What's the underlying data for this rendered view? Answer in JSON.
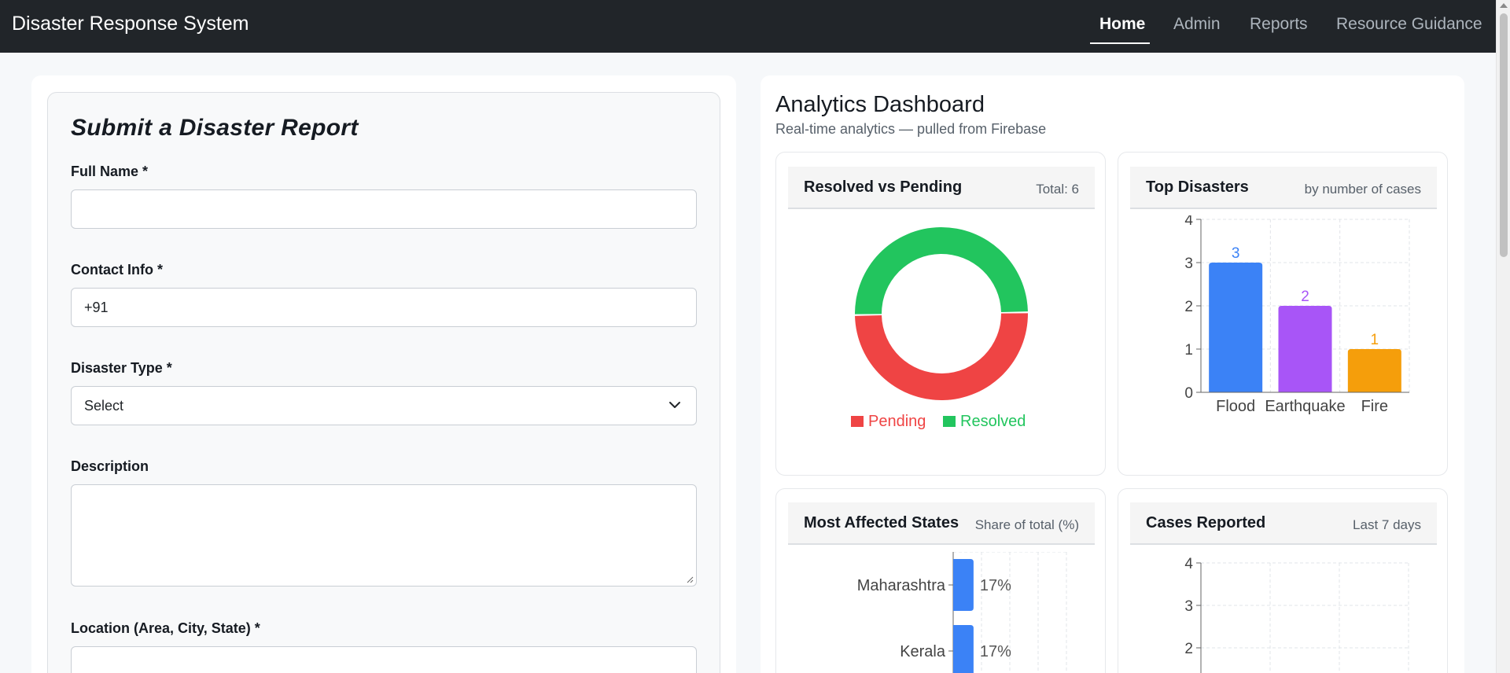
{
  "nav": {
    "brand": "Disaster Response System",
    "links": [
      {
        "label": "Home",
        "active": true
      },
      {
        "label": "Admin",
        "active": false
      },
      {
        "label": "Reports",
        "active": false
      },
      {
        "label": "Resource Guidance",
        "active": false
      }
    ]
  },
  "form": {
    "title": "Submit a Disaster Report",
    "full_name_label": "Full Name *",
    "full_name_value": "",
    "contact_label": "Contact Info *",
    "contact_value": "+91",
    "disaster_type_label": "Disaster Type *",
    "disaster_type_value": "Select",
    "description_label": "Description",
    "description_value": "",
    "location_label": "Location (Area, City, State) *",
    "location_value": ""
  },
  "dashboard": {
    "title": "Analytics Dashboard",
    "subtitle": "Real-time analytics — pulled from Firebase",
    "cards": {
      "resolved_pending": {
        "title": "Resolved vs Pending",
        "meta": "Total: 6"
      },
      "top_disasters": {
        "title": "Top Disasters",
        "meta": "by number of cases"
      },
      "affected_states": {
        "title": "Most Affected States",
        "meta": "Share of total (%)"
      },
      "cases_reported": {
        "title": "Cases Reported",
        "meta": "Last 7 days"
      }
    }
  },
  "colors": {
    "blue": "#3b82f6",
    "purple": "#a855f7",
    "orange": "#f59e0b",
    "red": "#ef4444",
    "green": "#22c55e"
  },
  "chart_data": [
    {
      "type": "pie",
      "title": "Resolved vs Pending",
      "categories": [
        "Pending",
        "Resolved"
      ],
      "values": [
        3,
        3
      ],
      "colors": [
        "#ef4444",
        "#22c55e"
      ],
      "legend": "bottom"
    },
    {
      "type": "bar",
      "title": "Top Disasters",
      "categories": [
        "Flood",
        "Earthquake",
        "Fire"
      ],
      "values": [
        3,
        2,
        1
      ],
      "colors": [
        "#3b82f6",
        "#a855f7",
        "#f59e0b"
      ],
      "ylim": [
        0,
        4
      ],
      "yticks": [
        0,
        1,
        2,
        3,
        4
      ],
      "grid": true
    },
    {
      "type": "bar",
      "orientation": "horizontal",
      "title": "Most Affected States",
      "categories": [
        "Maharashtra",
        "Kerala"
      ],
      "values": [
        17,
        17
      ],
      "value_suffix": "%",
      "color": "#3b82f6",
      "grid": true
    },
    {
      "type": "line",
      "title": "Cases Reported",
      "yticks_visible": [
        4,
        3,
        2
      ],
      "grid": true
    }
  ]
}
